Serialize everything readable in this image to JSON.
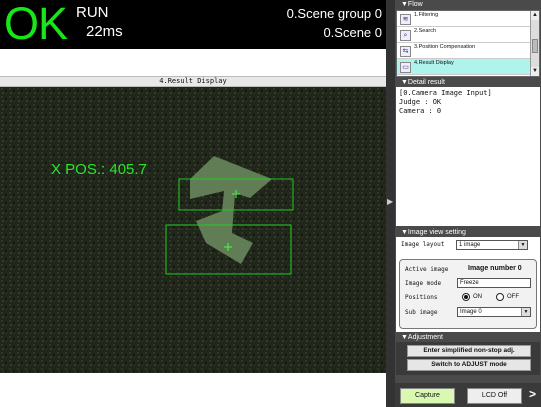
{
  "status": {
    "judgement": "OK",
    "mode": "RUN",
    "time": "22ms",
    "scene_group": "0.Scene group 0",
    "scene": "0.Scene 0",
    "judgement_color": "#19e619"
  },
  "image_panel": {
    "title": "4.Result Display",
    "overlay_text": "X POS.: 405.7",
    "overlay_color": "#2ae52a"
  },
  "flow": {
    "header": "▼Flow",
    "items": [
      {
        "label": "1.Filtering",
        "icon": "filter-icon",
        "glyph": "≋"
      },
      {
        "label": "2.Search",
        "icon": "search-icon",
        "glyph": "⌕"
      },
      {
        "label": "3.Position Compensation",
        "icon": "position-icon",
        "glyph": "⇆"
      },
      {
        "label": "4.Result Display",
        "icon": "display-icon",
        "glyph": "▭"
      }
    ],
    "active_index": 3
  },
  "detail": {
    "header": "▼Detail result",
    "lines": [
      "[0.Camera Image Input]",
      "",
      "Judge : OK",
      "Camera : 0"
    ]
  },
  "image_view": {
    "header": "▼Image view setting",
    "layout_label": "Image layout",
    "layout_value": "1 image",
    "active_label": "Active image",
    "active_value": "Image number 0",
    "mode_label": "Image mode",
    "mode_value": "Freeze",
    "positions_label": "Positions",
    "positions_on": "ON",
    "positions_off": "OFF",
    "positions_selected": "ON",
    "sub_label": "Sub image",
    "sub_value": "Image 0"
  },
  "adjustment": {
    "header": "▼Adjustment",
    "btn_simplified": "Enter simplified non-stop adj.",
    "btn_adjust": "Switch to ADJUST mode"
  },
  "bottom": {
    "capture": "Capture",
    "lcd_off": "LCD Off",
    "more": ">"
  }
}
